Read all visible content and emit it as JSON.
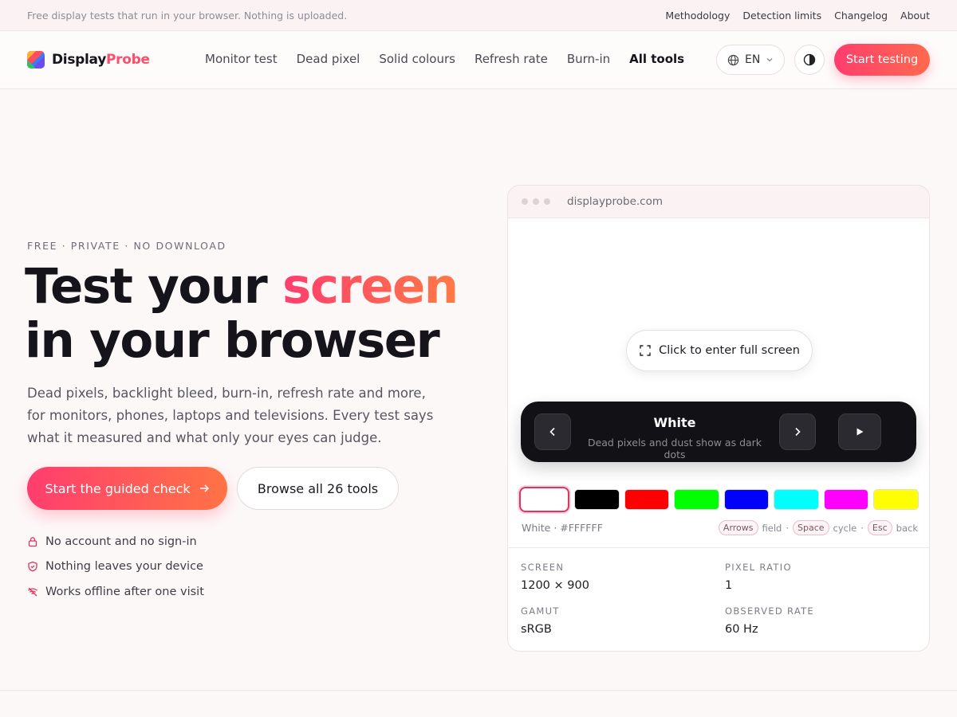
{
  "topbar": {
    "note": "Free display tests that run in your browser. Nothing is uploaded.",
    "links": [
      "Methodology",
      "Detection limits",
      "Changelog",
      "About"
    ]
  },
  "header": {
    "logo_part1": "Display",
    "logo_part2": "Probe",
    "nav": [
      "Monitor test",
      "Dead pixel",
      "Solid colours",
      "Refresh rate",
      "Burn-in",
      "All tools"
    ],
    "language": "EN",
    "cta": "Start testing"
  },
  "hero": {
    "eyebrow": "FREE · PRIVATE · NO DOWNLOAD",
    "title_line1_start": "Test your ",
    "title_line1_accent": "screen",
    "title_line2": "in your browser",
    "lead": "Dead pixels, backlight bleed, burn-in, refresh rate and more, for monitors, phones, laptops and televisions. Every test says what it measured and what only your eyes can judge.",
    "cta_primary": "Start the guided check",
    "cta_secondary": "Browse all 26 tools",
    "features": [
      "No account and no sign-in",
      "Nothing leaves your device",
      "Works offline after one visit"
    ]
  },
  "preview": {
    "url": "displayprobe.com",
    "fullscreen_label": "Click to enter full screen",
    "control_title": "White",
    "control_subtitle": "Dead pixels and dust show as dark dots",
    "swatches": [
      "#FFFFFF",
      "#000000",
      "#FF0000",
      "#00FF00",
      "#0000FF",
      "#00FFFF",
      "#FF00FF",
      "#FFFF00"
    ],
    "selected_label": "White · #FFFFFF",
    "keys": [
      {
        "key": "Arrows",
        "action": "field"
      },
      {
        "key": "Space",
        "action": "cycle"
      },
      {
        "key": "Esc",
        "action": "back"
      }
    ],
    "stats": [
      {
        "label": "SCREEN",
        "value": "1200 × 900"
      },
      {
        "label": "PIXEL RATIO",
        "value": "1"
      },
      {
        "label": "GAMUT",
        "value": "sRGB"
      },
      {
        "label": "OBSERVED RATE",
        "value": "60 Hz"
      }
    ]
  },
  "colors": {
    "accent": "#FF4D6A",
    "accent_end": "#FF7345",
    "text": "#14141A"
  }
}
